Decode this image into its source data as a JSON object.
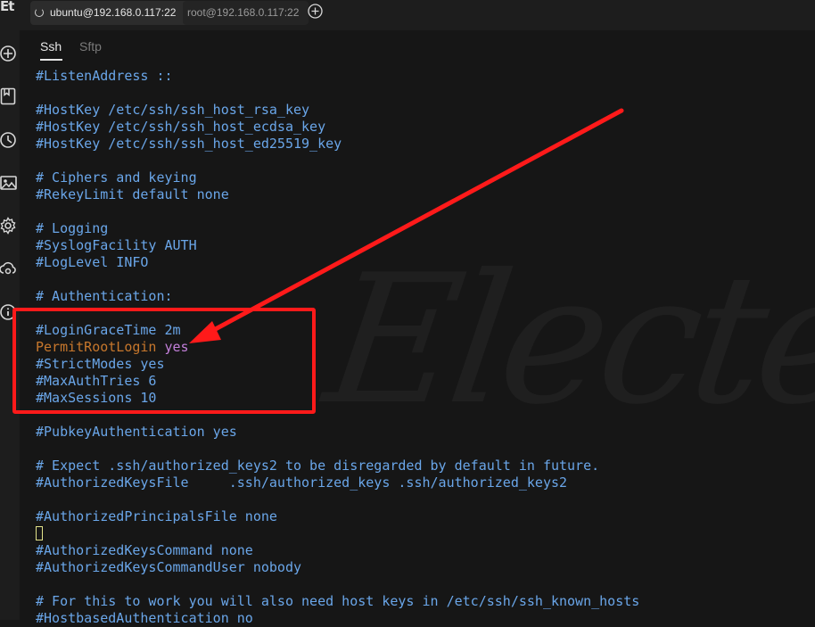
{
  "sidebar": {
    "logo": "Et",
    "icons": [
      "add-circle-icon",
      "bookmark-icon",
      "history-clock-icon",
      "image-icon",
      "gear-icon",
      "cloud-sync-icon",
      "info-icon"
    ]
  },
  "tabs": [
    {
      "label": "ubuntu@192.168.0.117:22",
      "active": true
    },
    {
      "label": "root@192.168.0.117:22",
      "active": false
    }
  ],
  "subtabs": {
    "ssh": "Ssh",
    "sftp": "Sftp"
  },
  "watermark": "Electe",
  "terminal": {
    "lines": [
      "#ListenAddress ::",
      "",
      "#HostKey /etc/ssh/ssh_host_rsa_key",
      "#HostKey /etc/ssh/ssh_host_ecdsa_key",
      "#HostKey /etc/ssh/ssh_host_ed25519_key",
      "",
      "# Ciphers and keying",
      "#RekeyLimit default none",
      "",
      "# Logging",
      "#SyslogFacility AUTH",
      "#LogLevel INFO",
      "",
      "# Authentication:",
      "",
      "#LoginGraceTime 2m",
      {
        "keyword": "PermitRootLogin",
        "value": "yes"
      },
      "#StrictModes yes",
      "#MaxAuthTries 6",
      "#MaxSessions 10",
      "",
      "#PubkeyAuthentication yes",
      "",
      "# Expect .ssh/authorized_keys2 to be disregarded by default in future.",
      "#AuthorizedKeysFile     .ssh/authorized_keys .ssh/authorized_keys2",
      "",
      "#AuthorizedPrincipalsFile none",
      "",
      "#AuthorizedKeysCommand none",
      "#AuthorizedKeysCommandUser nobody",
      "",
      "# For this to work you will also need host keys in /etc/ssh/ssh_known_hosts",
      "#HostbasedAuthentication no"
    ],
    "cursor_line": 27
  },
  "colors": {
    "comment": "#6aa6e9",
    "keyword": "#c7772c",
    "value": "#c27fd9",
    "annotation": "#ff1a1a"
  }
}
